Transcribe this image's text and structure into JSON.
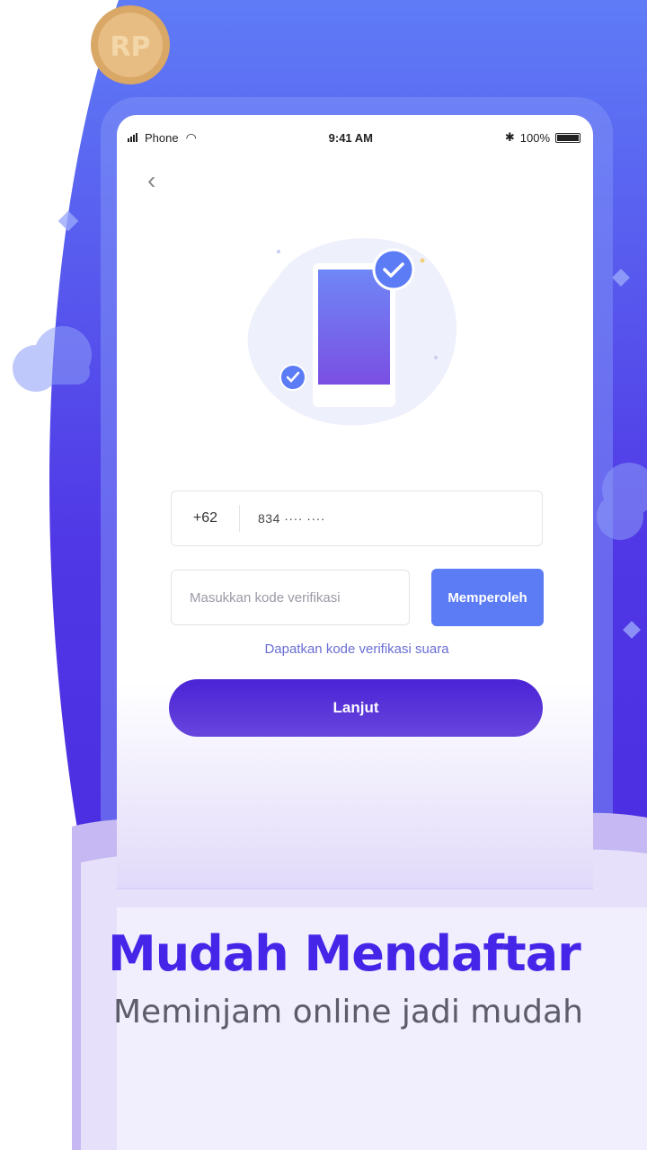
{
  "status_bar": {
    "carrier": "Phone",
    "time": "9:41 AM",
    "battery": "100%"
  },
  "badge": {
    "coin_label": "RP"
  },
  "form": {
    "country_code": "+62",
    "phone_number": "834 ···· ····",
    "verification_placeholder": "Masukkan kode verifikasi",
    "get_code_label": "Memperoleh",
    "voice_code_link": "Dapatkan kode verifikasi suara",
    "next_label": "Lanjut"
  },
  "promo": {
    "headline": "Mudah Mendaftar",
    "subline": "Meminjam online jadi mudah"
  },
  "icons": [
    "back-chevron-icon",
    "wifi-icon",
    "signal-icon",
    "bluetooth-icon",
    "battery-icon",
    "check-icon",
    "coin-icon"
  ],
  "colors": {
    "brand_purple": "#4c25d6",
    "accent_blue": "#5c7cf6",
    "headline": "#4526e8",
    "background_gradient_top": "#5b74f4",
    "background_gradient_bottom": "#4a2fe0"
  }
}
